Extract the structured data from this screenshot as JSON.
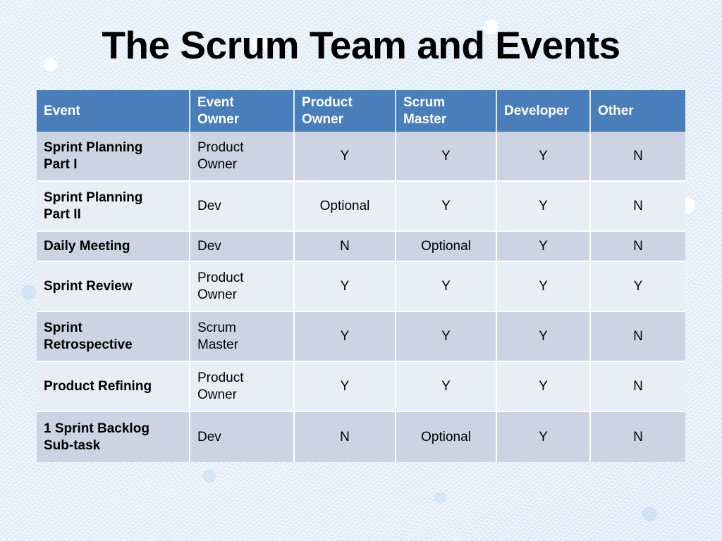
{
  "slide": {
    "title": "The Scrum Team and Events",
    "background_color": "#e8f1fb"
  },
  "table": {
    "header_bg": "#4a7ebb",
    "header_text_color": "#ffffff",
    "band_dark": "#ccd3e3",
    "band_light": "#e9edf6",
    "columns": [
      "Event",
      "Event\nOwner",
      "Product\nOwner",
      "Scrum\nMaster",
      "Developer",
      "Other"
    ],
    "headers": {
      "event": "Event",
      "event_owner_line1": "Event",
      "event_owner_line2": "Owner",
      "product_owner_line1": "Product",
      "product_owner_line2": "Owner",
      "scrum_master_line1": "Scrum",
      "scrum_master_line2": "Master",
      "developer": "Developer",
      "other": "Other"
    },
    "rows": [
      {
        "event_line1": "Sprint Planning",
        "event_line2": "Part I",
        "event_owner_line1": "Product",
        "event_owner_line2": "Owner",
        "product_owner": "Y",
        "scrum_master": "Y",
        "developer": "Y",
        "other": "N"
      },
      {
        "event_line1": "Sprint Planning",
        "event_line2": "Part II",
        "event_owner_line1": "Dev",
        "event_owner_line2": "",
        "product_owner": "Optional",
        "scrum_master": "Y",
        "developer": "Y",
        "other": "N"
      },
      {
        "event_line1": "Daily Meeting",
        "event_line2": "",
        "event_owner_line1": "Dev",
        "event_owner_line2": "",
        "product_owner": "N",
        "scrum_master": "Optional",
        "developer": "Y",
        "other": "N"
      },
      {
        "event_line1": "Sprint Review",
        "event_line2": "",
        "event_owner_line1": "Product",
        "event_owner_line2": "Owner",
        "product_owner": "Y",
        "scrum_master": "Y",
        "developer": "Y",
        "other": "Y"
      },
      {
        "event_line1": "Sprint",
        "event_line2": "Retrospective",
        "event_owner_line1": "Scrum",
        "event_owner_line2": "Master",
        "product_owner": "Y",
        "scrum_master": "Y",
        "developer": "Y",
        "other": "N"
      },
      {
        "event_line1": "Product Refining",
        "event_line2": "",
        "event_owner_line1": "Product",
        "event_owner_line2": "Owner",
        "product_owner": "Y",
        "scrum_master": "Y",
        "developer": "Y",
        "other": "N"
      },
      {
        "event_line1": "1 Sprint Backlog",
        "event_line2": "Sub-task",
        "event_owner_line1": "Dev",
        "event_owner_line2": "",
        "product_owner": "N",
        "scrum_master": "Optional",
        "developer": "Y",
        "other": "N"
      }
    ]
  }
}
